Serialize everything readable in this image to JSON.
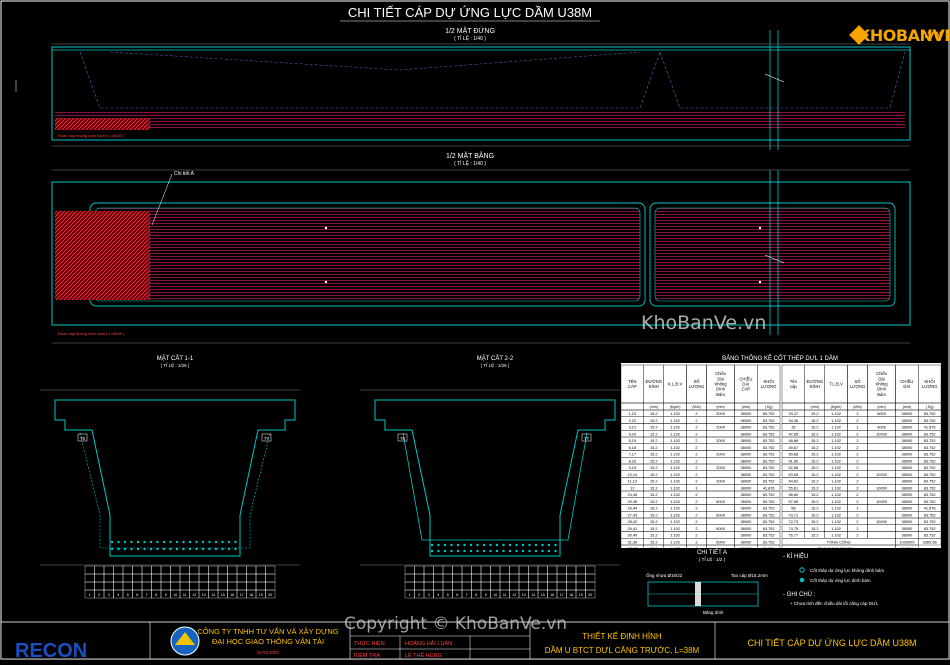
{
  "title": "CHI TIẾT CÁP DỰ ỨNG LỰC DẦM U38M",
  "views": {
    "elevation": {
      "title": "1/2 MẶT ĐỨNG",
      "scale": "( TỈ LỆ : 1/40 )"
    },
    "plan": {
      "title": "1/2 MẶT BẰNG",
      "scale": "( TỈ LỆ : 1/40 )",
      "callout": "Chi tiết A"
    },
    "section1": {
      "title": "MẶT CẮT 1-1",
      "scale": "( TỈ LỆ : 1/25 )",
      "tags": [
        "76",
        "77"
      ]
    },
    "section2": {
      "title": "MẶT CẮT 2-2",
      "scale": "( TỈ LỆ : 1/25 )",
      "tags": [
        "76",
        "77"
      ]
    },
    "detail": {
      "title": "CHI TIẾT A",
      "scale": "( TỈ LỆ : 1/2 )",
      "labels": [
        "Ống nhựa Ø16/22",
        "Tao cáp Ø15.2mm",
        "Băng dính"
      ]
    }
  },
  "table": {
    "title": "BẢNG THỐNG KÊ CỐT THÉP DƯL 1 DẦM",
    "left_headers": [
      "TÊN CÁP",
      "ĐƯỜNG KÍNH",
      "K.L.Đ.V",
      "SỐ LƯỢNG",
      "Chiều Dài Không Dính Bám",
      "CHIỀU DÀI CÁP",
      "KHỐI LƯỢNG"
    ],
    "right_headers": [
      "Tên cáp",
      "ĐƯỜNG KÍNH",
      "T.L.Đ.V",
      "SỐ LƯỢNG",
      "Chiều Dài Không Dính Bám",
      "CHIỀU DÀI",
      "KHỐI LƯỢNG"
    ],
    "units": [
      "(mm)",
      "(Kg/m)",
      "(t/bộ)",
      "(mm)",
      "(mm)",
      "( Kg)"
    ],
    "left_rows": [
      [
        "1,23",
        "15.2",
        "1.102",
        "2",
        "2000",
        "38000",
        "83.752"
      ],
      [
        "2,22",
        "15.2",
        "1.102",
        "2",
        "",
        "38000",
        "83.752"
      ],
      [
        "3,21",
        "15.2",
        "1.102",
        "2",
        "2000",
        "38000",
        "83.752"
      ],
      [
        "4,20",
        "15.2",
        "1.102",
        "2",
        "",
        "38000",
        "83.752"
      ],
      [
        "5,19",
        "15.2",
        "1.102",
        "2",
        "2000",
        "38000",
        "83.752"
      ],
      [
        "6,18",
        "15.2",
        "1.102",
        "2",
        "",
        "38000",
        "83.752"
      ],
      [
        "7,17",
        "15.2",
        "1.102",
        "2",
        "2000",
        "38000",
        "83.752"
      ],
      [
        "8,16",
        "15.2",
        "1.102",
        "2",
        "",
        "38000",
        "83.752"
      ],
      [
        "9,15",
        "15.2",
        "1.102",
        "2",
        "2000",
        "38000",
        "83.752"
      ],
      [
        "10,14",
        "15.2",
        "1.102",
        "2",
        "",
        "38000",
        "83.752"
      ],
      [
        "11,13",
        "15.2",
        "1.102",
        "2",
        "2000",
        "38000",
        "83.752"
      ],
      [
        "12",
        "15.2",
        "1.102",
        "1",
        "",
        "38000",
        "41.876"
      ],
      [
        "24,46",
        "15.2",
        "1.102",
        "2",
        "",
        "38000",
        "83.752"
      ],
      [
        "25,45",
        "15.2",
        "1.102",
        "2",
        "6000",
        "38000",
        "83.752"
      ],
      [
        "26,44",
        "15.2",
        "1.102",
        "2",
        "",
        "38000",
        "83.752"
      ],
      [
        "27,43",
        "15.2",
        "1.102",
        "2",
        "6000",
        "38000",
        "83.752"
      ],
      [
        "28,42",
        "15.2",
        "1.102",
        "2",
        "",
        "38000",
        "83.752"
      ],
      [
        "29,41",
        "15.2",
        "1.102",
        "2",
        "6000",
        "38000",
        "83.752"
      ],
      [
        "30,40",
        "15.2",
        "1.102",
        "2",
        "",
        "38000",
        "83.752"
      ],
      [
        "31,39",
        "15.2",
        "1.102",
        "2",
        "6000",
        "38000",
        "83.752"
      ],
      [
        "32,38",
        "15.2",
        "1.102",
        "2",
        "",
        "38000",
        "83.752"
      ]
    ],
    "right_rows": [
      [
        "33,37",
        "15.2",
        "1.102",
        "2",
        "6000",
        "38000",
        "83.752"
      ],
      [
        "34,36",
        "15.2",
        "1.102",
        "2",
        "",
        "38000",
        "83.752"
      ],
      [
        "35",
        "15.2",
        "1.102",
        "1",
        "6000",
        "38000",
        "41.876"
      ],
      [
        "47,65",
        "15.2",
        "1.102",
        "2",
        "10000",
        "38000",
        "83.752"
      ],
      [
        "48,66",
        "15.2",
        "1.102",
        "2",
        "",
        "38000",
        "83.752"
      ],
      [
        "49,67",
        "15.2",
        "1.102",
        "2",
        "",
        "38000",
        "83.752"
      ],
      [
        "50,68",
        "15.2",
        "1.102",
        "2",
        "",
        "38000",
        "83.752"
      ],
      [
        "51,69",
        "15.2",
        "1.102",
        "2",
        "",
        "38000",
        "83.752"
      ],
      [
        "52,66",
        "15.2",
        "1.102",
        "2",
        "",
        "38000",
        "83.752"
      ],
      [
        "53,65",
        "15.2",
        "1.102",
        "2",
        "10000",
        "38000",
        "83.752"
      ],
      [
        "54,62",
        "15.2",
        "1.102",
        "2",
        "",
        "38000",
        "83.752"
      ],
      [
        "55,61",
        "15.2",
        "1.102",
        "2",
        "10000",
        "38000",
        "83.752"
      ],
      [
        "56,60",
        "15.2",
        "1.102",
        "2",
        "",
        "38000",
        "83.752"
      ],
      [
        "57,59",
        "15.2",
        "1.102",
        "2",
        "10000",
        "38000",
        "83.752"
      ],
      [
        "58",
        "15.2",
        "1.102",
        "1",
        "",
        "38000",
        "41.876"
      ],
      [
        "70,71",
        "15.2",
        "1.102",
        "2",
        "",
        "38000",
        "83.752"
      ],
      [
        "72,73",
        "15.2",
        "1.102",
        "2",
        "10000",
        "38000",
        "83.752"
      ],
      [
        "74,75",
        "15.2",
        "1.102",
        "2",
        "",
        "38000",
        "83.752"
      ],
      [
        "76,77",
        "15.2",
        "1.102",
        "2",
        "",
        "38000",
        "83.752"
      ]
    ],
    "total_label": "TỔNG CỘNG",
    "total_length": "1026000",
    "total_weight": "3365.66",
    "pipe_label": "ỐNG NHỰA Ø16/22 mm",
    "pipe_value": "116000"
  },
  "legend": {
    "title": "- KÍ HIỆU",
    "items": [
      "Cốt thép dự ứng lực không dính bám",
      "Cốt thép dự ứng lực dính bám"
    ],
    "note_title": "- GHI CHÚ :",
    "notes": [
      "+ Chưa tính đến chiều dài tối căng cáp DƯL"
    ]
  },
  "title_block": {
    "company": "CÔNG TY TNHH TƯ VẤN VÀ XÂY DỰNG",
    "university": "ĐẠI HỌC GIAO THÔNG VẬN TẢI",
    "director": "GIÁM ĐỐC",
    "roles": [
      "THỰC HIỆN",
      "KIỂM TRA"
    ],
    "names": [
      "HOÀNG HẢI LUÂN",
      "LÊ THẾ HÙNG"
    ],
    "project_1": "THIẾT KẾ ĐỊNH HÌNH",
    "project_2": "DẦM U BTCT DƯL CĂNG TRƯỚC, L=38M",
    "sheet_title": "CHI TIẾT CÁP DỰ ỨNG LỰC DẦM U38M"
  },
  "watermarks": {
    "logo_text": "KHOBANVE",
    "logo_suffix": ".VN",
    "main": "KhoBanVe.vn",
    "copyright": "Copyright © KhoBanVe.vn"
  },
  "colors": {
    "background": "#000000",
    "frame": "#ffffff",
    "concrete": "#00c8c8",
    "tendon": "#d81b60",
    "hatch": "#ff2020",
    "text": "#ffffff",
    "watermark": "#c8c8c8",
    "logo": "#f5a400"
  }
}
